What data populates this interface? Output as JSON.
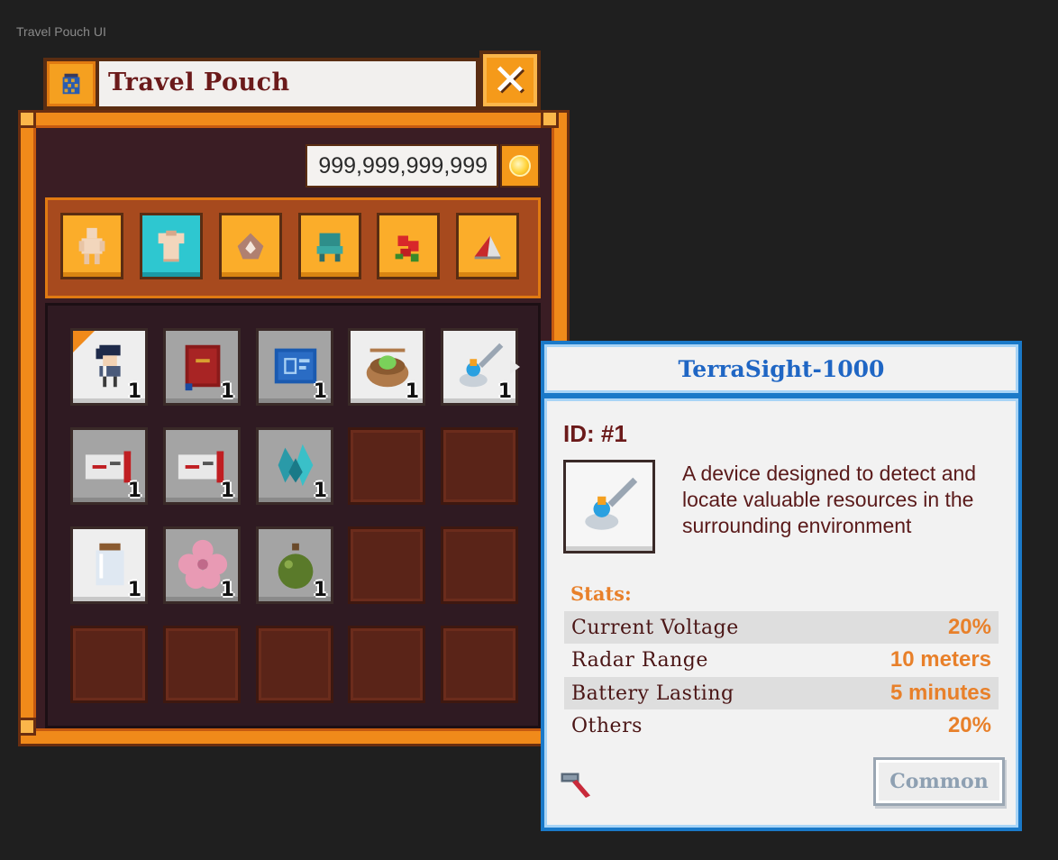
{
  "page_label": "Travel Pouch UI",
  "window": {
    "title": "Travel Pouch",
    "close_glyph": "✕"
  },
  "currency": {
    "amount": "999,999,999,999",
    "icon": "gold-coin-icon"
  },
  "tabs": [
    {
      "name": "body",
      "icon": "body-icon",
      "active": false
    },
    {
      "name": "clothing",
      "icon": "shirt-icon",
      "active": true
    },
    {
      "name": "material",
      "icon": "ore-icon",
      "active": false
    },
    {
      "name": "furniture",
      "icon": "chair-icon",
      "active": false
    },
    {
      "name": "plants",
      "icon": "flower-icon",
      "active": false
    },
    {
      "name": "tools",
      "icon": "shovel-icon",
      "active": false
    }
  ],
  "inventory": [
    [
      {
        "item": "character-figure",
        "qty": "1",
        "bg": "white",
        "flagged": true
      },
      {
        "item": "red-book",
        "qty": "1",
        "bg": "grey"
      },
      {
        "item": "blueprint",
        "qty": "1",
        "bg": "grey"
      },
      {
        "item": "egg-basket",
        "qty": "1",
        "bg": "white"
      },
      {
        "item": "terrasight-scanner",
        "qty": "1",
        "bg": "white",
        "selected": true
      }
    ],
    [
      {
        "item": "ticket",
        "qty": "1",
        "bg": "grey"
      },
      {
        "item": "ticket",
        "qty": "1",
        "bg": "grey"
      },
      {
        "item": "crystal",
        "qty": "1",
        "bg": "grey"
      },
      {
        "item": null
      },
      {
        "item": null
      }
    ],
    [
      {
        "item": "glass-jar",
        "qty": "1",
        "bg": "white"
      },
      {
        "item": "pink-flower",
        "qty": "1",
        "bg": "grey"
      },
      {
        "item": "green-potion",
        "qty": "1",
        "bg": "grey"
      },
      {
        "item": null
      },
      {
        "item": null
      }
    ],
    [
      {
        "item": null
      },
      {
        "item": null
      },
      {
        "item": null
      },
      {
        "item": null
      },
      {
        "item": null
      }
    ]
  ],
  "tooltip": {
    "title": "TerraSight-1000",
    "id": "ID: #1",
    "description": "A device designed to detect and locate valuable resources in the surrounding environment",
    "stats_label": "Stats:",
    "stats": [
      {
        "name": "Current Voltage",
        "value": "20%"
      },
      {
        "name": "Radar Range",
        "value": "10 meters"
      },
      {
        "name": "Battery Lasting",
        "value": "5 minutes"
      },
      {
        "name": "Others",
        "value": "20%"
      }
    ],
    "category_icon": "hammer-icon",
    "rarity": "Common"
  },
  "colors": {
    "frame_orange": "#f08a1a",
    "tooltip_blue": "#1a79c8",
    "accent_orange": "#e8802a",
    "maroon_text": "#6b1a1a",
    "active_tab": "#2ec7d0"
  }
}
